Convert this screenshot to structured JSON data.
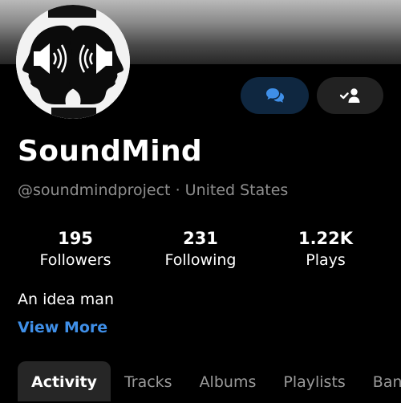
{
  "profile": {
    "name": "SoundMind",
    "handle": "@soundmindproject",
    "location": "United States",
    "bio": "An idea man",
    "view_more": "View More"
  },
  "separator": "·",
  "stats": [
    {
      "value": "195",
      "label": "Followers"
    },
    {
      "value": "231",
      "label": "Following"
    },
    {
      "value": "1.22K",
      "label": "Plays"
    }
  ],
  "tabs": [
    {
      "label": "Activity",
      "active": true
    },
    {
      "label": "Tracks",
      "active": false
    },
    {
      "label": "Albums",
      "active": false
    },
    {
      "label": "Playlists",
      "active": false
    },
    {
      "label": "Ban",
      "active": false
    }
  ],
  "icons": {
    "message": "chat-bubbles-icon",
    "follow": "user-check-icon"
  },
  "colors": {
    "accent": "#3f8fe8",
    "message_button": "#0f2740",
    "follow_button": "#222222",
    "muted_text": "#8e8e8e"
  }
}
